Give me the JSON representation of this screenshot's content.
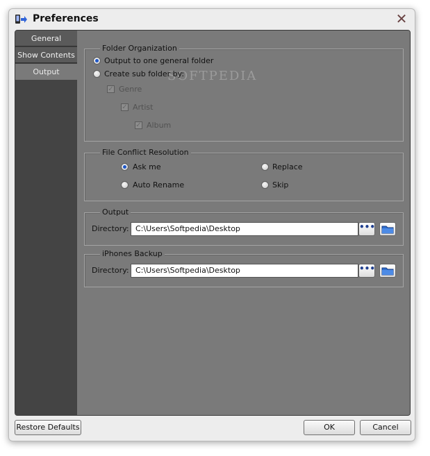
{
  "window": {
    "title": "Preferences",
    "app_icon": "app-transfer-icon",
    "close_icon": "close-icon"
  },
  "sidebar": {
    "items": [
      {
        "label": "General"
      },
      {
        "label": "Show Contents"
      },
      {
        "label": "Output",
        "selected": true
      }
    ]
  },
  "folder_organization": {
    "legend": "Folder Organization",
    "option_general": {
      "label": "Output to one general folder",
      "selected": true
    },
    "option_sub": {
      "label": "Create sub folder by:",
      "selected": false
    },
    "genre": {
      "label": "Genre",
      "checked": true,
      "enabled": false
    },
    "artist": {
      "label": "Artist",
      "checked": true,
      "enabled": false
    },
    "album": {
      "label": "Album",
      "checked": true,
      "enabled": false
    }
  },
  "conflict": {
    "legend": "File Conflict Resolution",
    "ask": {
      "label": "Ask me",
      "selected": true
    },
    "replace": {
      "label": "Replace",
      "selected": false
    },
    "rename": {
      "label": "Auto Rename",
      "selected": false
    },
    "skip": {
      "label": "Skip",
      "selected": false
    }
  },
  "output": {
    "legend": "Output",
    "dir_label": "Directory:",
    "path": "C:\\Users\\Softpedia\\Desktop",
    "browse_label": "•••"
  },
  "backup": {
    "legend": "iPhones Backup",
    "dir_label": "Directory:",
    "path": "C:\\Users\\Softpedia\\Desktop",
    "browse_label": "•••"
  },
  "watermark": "SOFTPEDIA",
  "buttons": {
    "restore": "Restore Defaults",
    "ok": "OK",
    "cancel": "Cancel"
  },
  "colors": {
    "sidebar_bg": "#444444",
    "panel_bg": "#7a7a7a",
    "radio_selected": "#1e57c8"
  }
}
